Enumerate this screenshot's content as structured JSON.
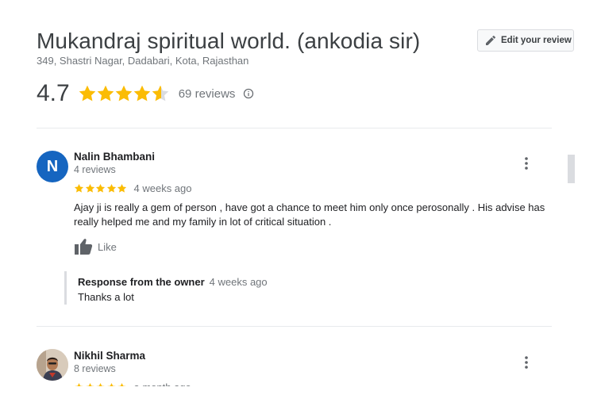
{
  "place": {
    "title": "Mukandraj spiritual world. (ankodia sir)",
    "address": "349, Shastri Nagar, Dadabari, Kota, Rajasthan",
    "rating": "4.7",
    "rating_value": 4.7,
    "review_count": "69 reviews",
    "edit_review_label": "Edit your review",
    "icons": {
      "edit": "pencil-icon",
      "info": "info-icon",
      "star": "star-icon",
      "more": "more-vert-icon",
      "like": "thumbs-up-icon"
    },
    "colors": {
      "star": "#fbbc04",
      "star_empty": "#dadce0",
      "avatar_n": "#1565c0"
    }
  },
  "reviews": [
    {
      "avatar_initial": "N",
      "name": "Nalin Bhambani",
      "meta": "4 reviews",
      "stars": 5,
      "time": "4 weeks ago",
      "text": "Ajay ji is really a gem of person , have got a chance to meet him only once perosonally . His advise has really helped me and my family in lot of critical situation .",
      "like_label": "Like",
      "response": {
        "label": "Response from the owner",
        "time": "4 weeks ago",
        "text": "Thanks a lot"
      }
    },
    {
      "name": "Nikhil Sharma",
      "meta": "8 reviews",
      "stars": 5,
      "time": "a month ago"
    }
  ]
}
